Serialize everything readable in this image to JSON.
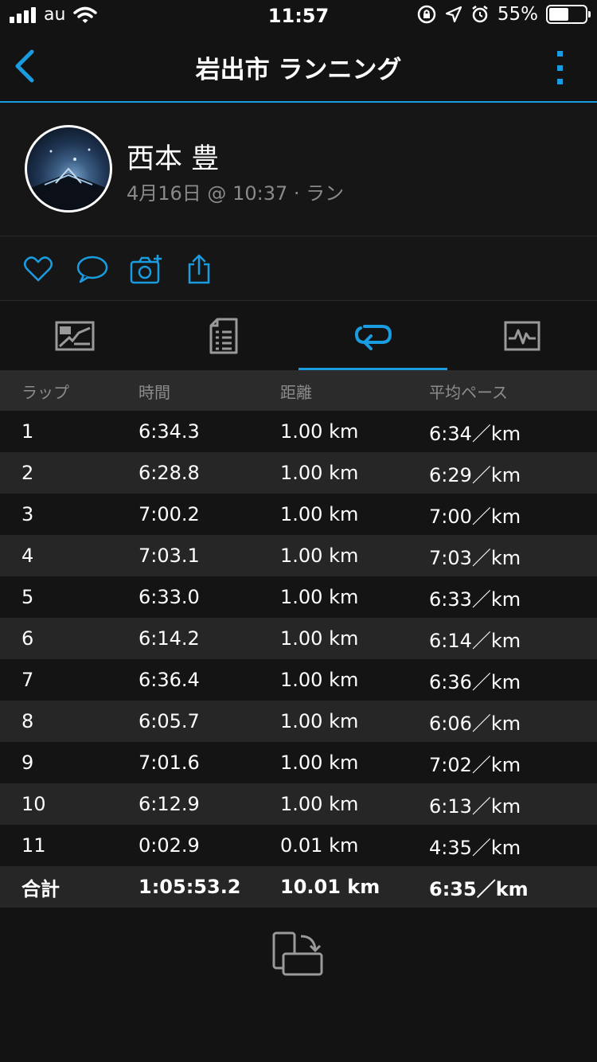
{
  "status_bar": {
    "carrier": "au",
    "time": "11:57",
    "battery": "55%",
    "battery_level": 0.55
  },
  "header": {
    "title": "岩出市 ランニング"
  },
  "profile": {
    "name": "西本 豊",
    "meta": "4月16日 @ 10:37 · ラン"
  },
  "actions": [
    "heart-icon",
    "comment-icon",
    "add-photo-icon",
    "share-icon"
  ],
  "tabs": [
    {
      "icon": "map-icon",
      "active": false
    },
    {
      "icon": "details-icon",
      "active": false
    },
    {
      "icon": "laps-icon",
      "active": true
    },
    {
      "icon": "chart-icon",
      "active": false
    }
  ],
  "table": {
    "headers": [
      "ラップ",
      "時間",
      "距離",
      "平均ペース"
    ],
    "rows": [
      [
        "1",
        "6:34.3",
        "1.00 km",
        "6:34／km"
      ],
      [
        "2",
        "6:28.8",
        "1.00 km",
        "6:29／km"
      ],
      [
        "3",
        "7:00.2",
        "1.00 km",
        "7:00／km"
      ],
      [
        "4",
        "7:03.1",
        "1.00 km",
        "7:03／km"
      ],
      [
        "5",
        "6:33.0",
        "1.00 km",
        "6:33／km"
      ],
      [
        "6",
        "6:14.2",
        "1.00 km",
        "6:14／km"
      ],
      [
        "7",
        "6:36.4",
        "1.00 km",
        "6:36／km"
      ],
      [
        "8",
        "6:05.7",
        "1.00 km",
        "6:06／km"
      ],
      [
        "9",
        "7:01.6",
        "1.00 km",
        "7:02／km"
      ],
      [
        "10",
        "6:12.9",
        "1.00 km",
        "6:13／km"
      ],
      [
        "11",
        "0:02.9",
        "0.01 km",
        "4:35／km"
      ]
    ],
    "total": [
      "合計",
      "1:05:53.2",
      "10.01 km",
      "6:35／km"
    ]
  },
  "colors": {
    "accent": "#1a9ce0",
    "background": "#131313",
    "icon_gray": "#9a9a9a"
  }
}
